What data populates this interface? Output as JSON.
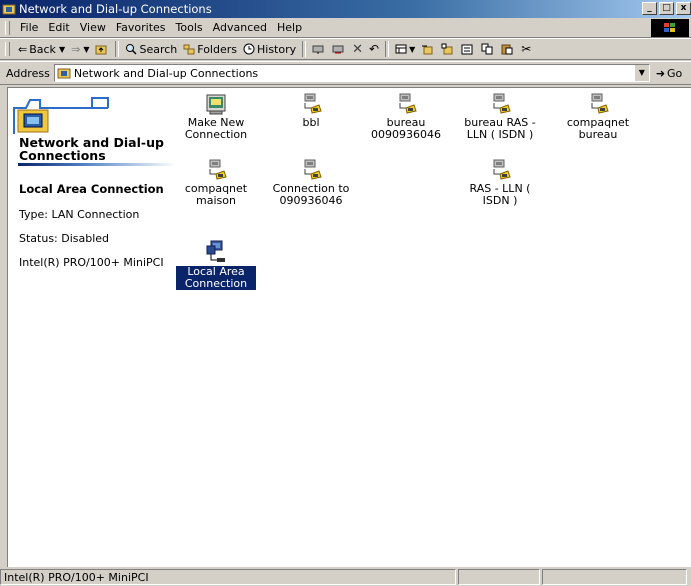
{
  "window": {
    "title": "Network and Dial-up Connections",
    "buttons": [
      "minimize",
      "maximize",
      "close"
    ]
  },
  "menu": [
    "File",
    "Edit",
    "View",
    "Favorites",
    "Tools",
    "Advanced",
    "Help"
  ],
  "toolbar": {
    "back": "Back",
    "search": "Search",
    "folders": "Folders",
    "history": "History"
  },
  "address": {
    "label": "Address",
    "value": "Network and Dial-up Connections",
    "go": "Go"
  },
  "left_pane": {
    "title": "Network and Dial-up Connections",
    "selected_name": "Local Area Connection",
    "type": "Type: LAN Connection",
    "status": "Status: Disabled",
    "device": "Intel(R) PRO/100+ MiniPCI"
  },
  "icons": [
    {
      "label": "Make New Connection",
      "icon": "wizard-icon"
    },
    {
      "label": "bbl",
      "icon": "dialup-icon"
    },
    {
      "label": "bureau 0090936046",
      "icon": "dialup-icon"
    },
    {
      "label": "bureau RAS - LLN ( ISDN )",
      "icon": "dialup-icon"
    },
    {
      "label": "compaqnet bureau",
      "icon": "dialup-icon"
    },
    {
      "label": "compaqnet maison",
      "icon": "dialup-icon"
    },
    {
      "label": "Connection to 090936046",
      "icon": "dialup-icon"
    },
    {
      "label": "RAS - LLN ( ISDN )",
      "icon": "dialup-icon"
    },
    {
      "label": "Local Area Connection",
      "icon": "lan-icon",
      "selected": true
    }
  ],
  "status": {
    "text": "Intel(R) PRO/100+ MiniPCI"
  },
  "colors": {
    "titlebar": "#0a246a",
    "selection": "#0a246a",
    "chrome": "#d4d0c8"
  }
}
